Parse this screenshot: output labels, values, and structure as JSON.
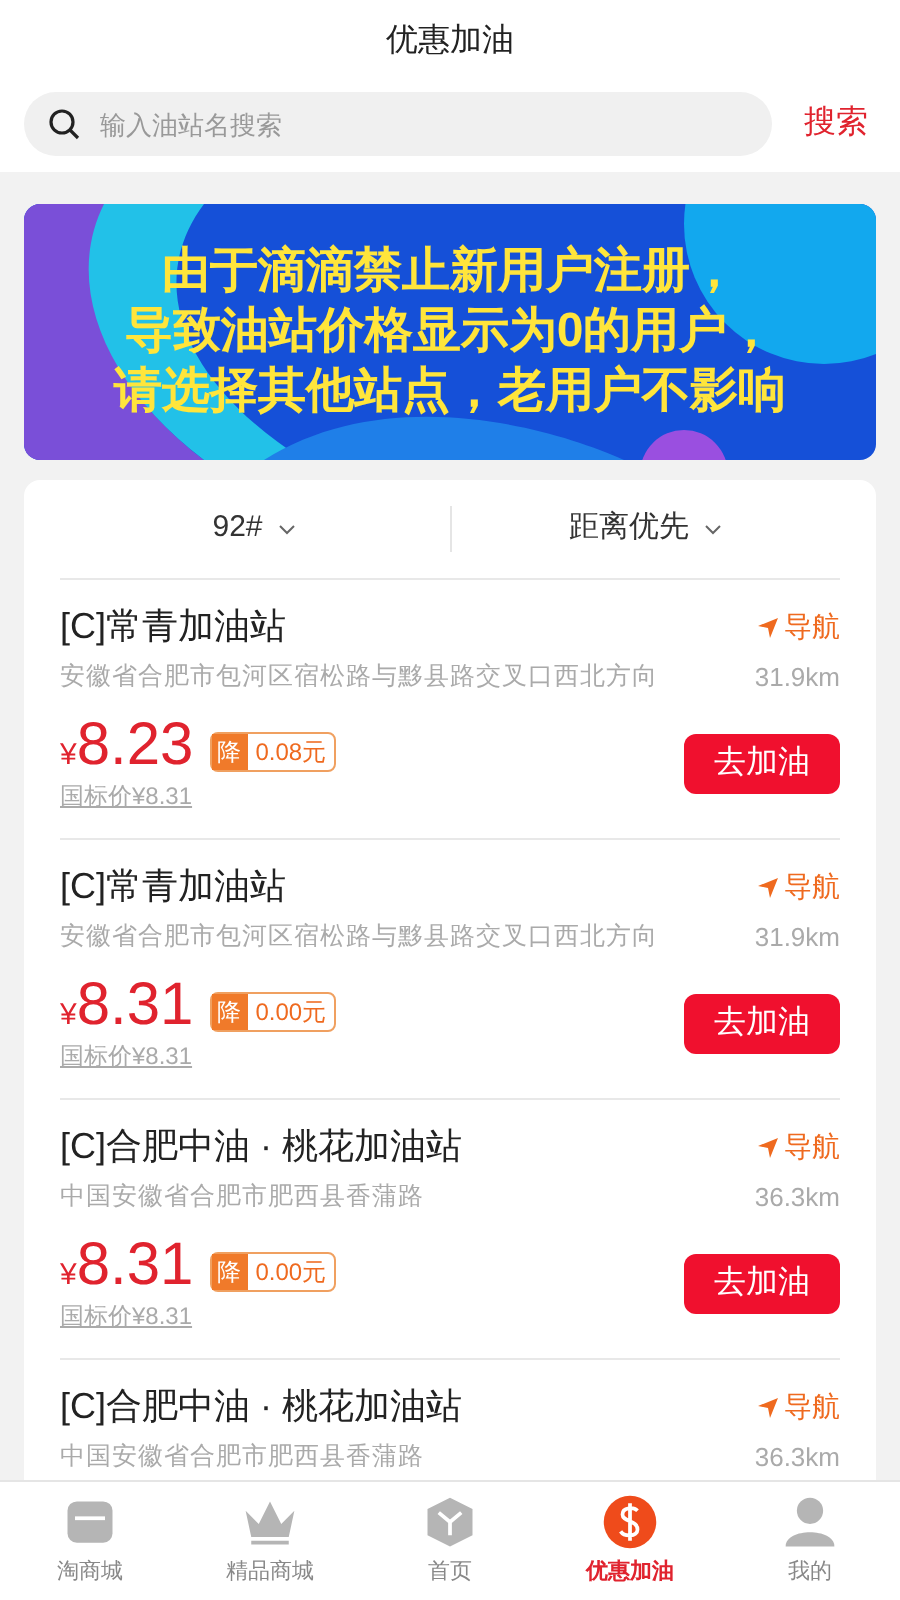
{
  "header": {
    "title": "优惠加油"
  },
  "search": {
    "placeholder": "输入油站名搜索",
    "button": "搜索"
  },
  "banner": {
    "lines": [
      "由于滴滴禁止新用户注册，",
      "导致油站价格显示为0的用户，",
      "请选择其他站点，老用户不影响"
    ]
  },
  "filters": [
    {
      "label": "92#"
    },
    {
      "label": "距离优先"
    }
  ],
  "stations": [
    {
      "name": "[C]常青加油站",
      "nav": "导航",
      "address": "安徽省合肥市包河区宿松路与黟县路交叉口西北方向",
      "distance": "31.9km",
      "currency": "¥",
      "price": "8.23",
      "drop_label": "降",
      "drop": "0.08元",
      "list_price": "国标价¥8.31",
      "action": "去加油"
    },
    {
      "name": "[C]常青加油站",
      "nav": "导航",
      "address": "安徽省合肥市包河区宿松路与黟县路交叉口西北方向",
      "distance": "31.9km",
      "currency": "¥",
      "price": "8.31",
      "drop_label": "降",
      "drop": "0.00元",
      "list_price": "国标价¥8.31",
      "action": "去加油"
    },
    {
      "name": "[C]合肥中油 · 桃花加油站",
      "nav": "导航",
      "address": "中国安徽省合肥市肥西县香蒲路",
      "distance": "36.3km",
      "currency": "¥",
      "price": "8.31",
      "drop_label": "降",
      "drop": "0.00元",
      "list_price": "国标价¥8.31",
      "action": "去加油"
    },
    {
      "name": "[C]合肥中油 · 桃花加油站",
      "nav": "导航",
      "address": "中国安徽省合肥市肥西县香蒲路",
      "distance": "36.3km"
    }
  ],
  "tabbar": [
    {
      "kind": "store",
      "label": "淘商城",
      "selected": false
    },
    {
      "kind": "crown",
      "label": "精品商城",
      "selected": false
    },
    {
      "kind": "home",
      "label": "首页",
      "selected": false
    },
    {
      "kind": "fuel",
      "label": "优惠加油",
      "selected": true
    },
    {
      "kind": "user",
      "label": "我的",
      "selected": false
    }
  ]
}
